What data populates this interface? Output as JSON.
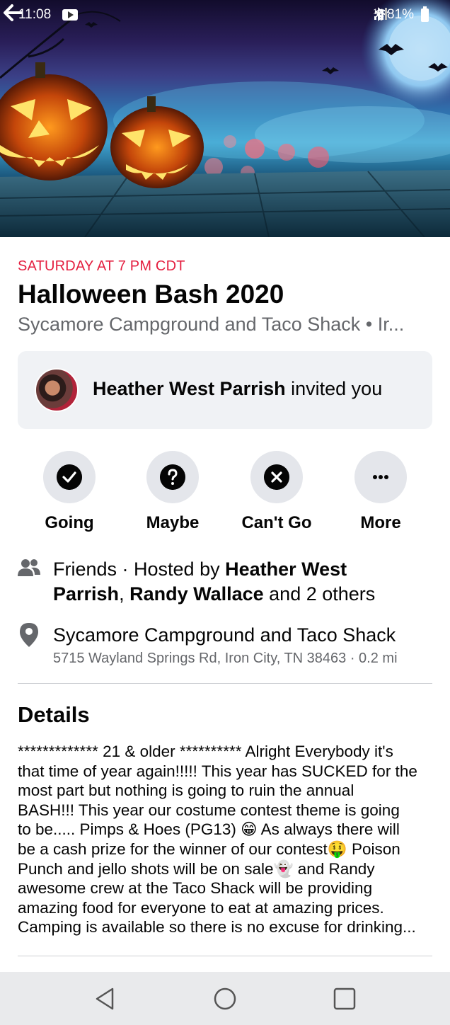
{
  "status_bar": {
    "time": "11:08",
    "data_label": "1X",
    "battery": "81%"
  },
  "event": {
    "when": "SATURDAY AT 7 PM CDT",
    "title": "Halloween Bash 2020",
    "place_line": "Sycamore Campground and Taco Shack • Ir..."
  },
  "invite": {
    "name": "Heather West Parrish",
    "suffix": " invited you"
  },
  "rsvp": [
    {
      "label": "Going",
      "icon": "check-icon"
    },
    {
      "label": "Maybe",
      "icon": "question-icon"
    },
    {
      "label": "Can't Go",
      "icon": "x-icon"
    },
    {
      "label": "More",
      "icon": "more-icon"
    }
  ],
  "hosts": {
    "prefix": "Friends · Hosted by ",
    "host1": "Heather West",
    "host1b": "Parrish",
    "sep": ", ",
    "host2": "Randy Wallace",
    "suffix": " and 2 others"
  },
  "location": {
    "name": "Sycamore Campground and Taco Shack",
    "address": "5715  Wayland Springs Rd, Iron City, TN 38463 · 0.2 mi"
  },
  "details": {
    "heading": "Details",
    "lines": [
      "************* 21 & older ********** Alright Everybody it's",
      "that time of year again!!!!! This year has SUCKED for the",
      "most part but nothing is going to ruin the annual",
      "BASH!!! This year our costume contest theme is going",
      "to be..... Pimps & Hoes (PG13) 😁 As always there will",
      "be a cash prize for the winner of our contest🤑 Poison",
      "Punch and jello shots will be on sale👻 and Randy",
      "awesome crew at the Taco Shack will be providing",
      "amazing food for everyone to eat at amazing prices.",
      "Camping is available so there is no excuse for drinking..."
    ]
  },
  "colors": {
    "accent_red": "#e41e3f",
    "secondary_text": "#65676b",
    "card_bg": "#f0f2f5",
    "button_bg": "#e4e6eb"
  }
}
